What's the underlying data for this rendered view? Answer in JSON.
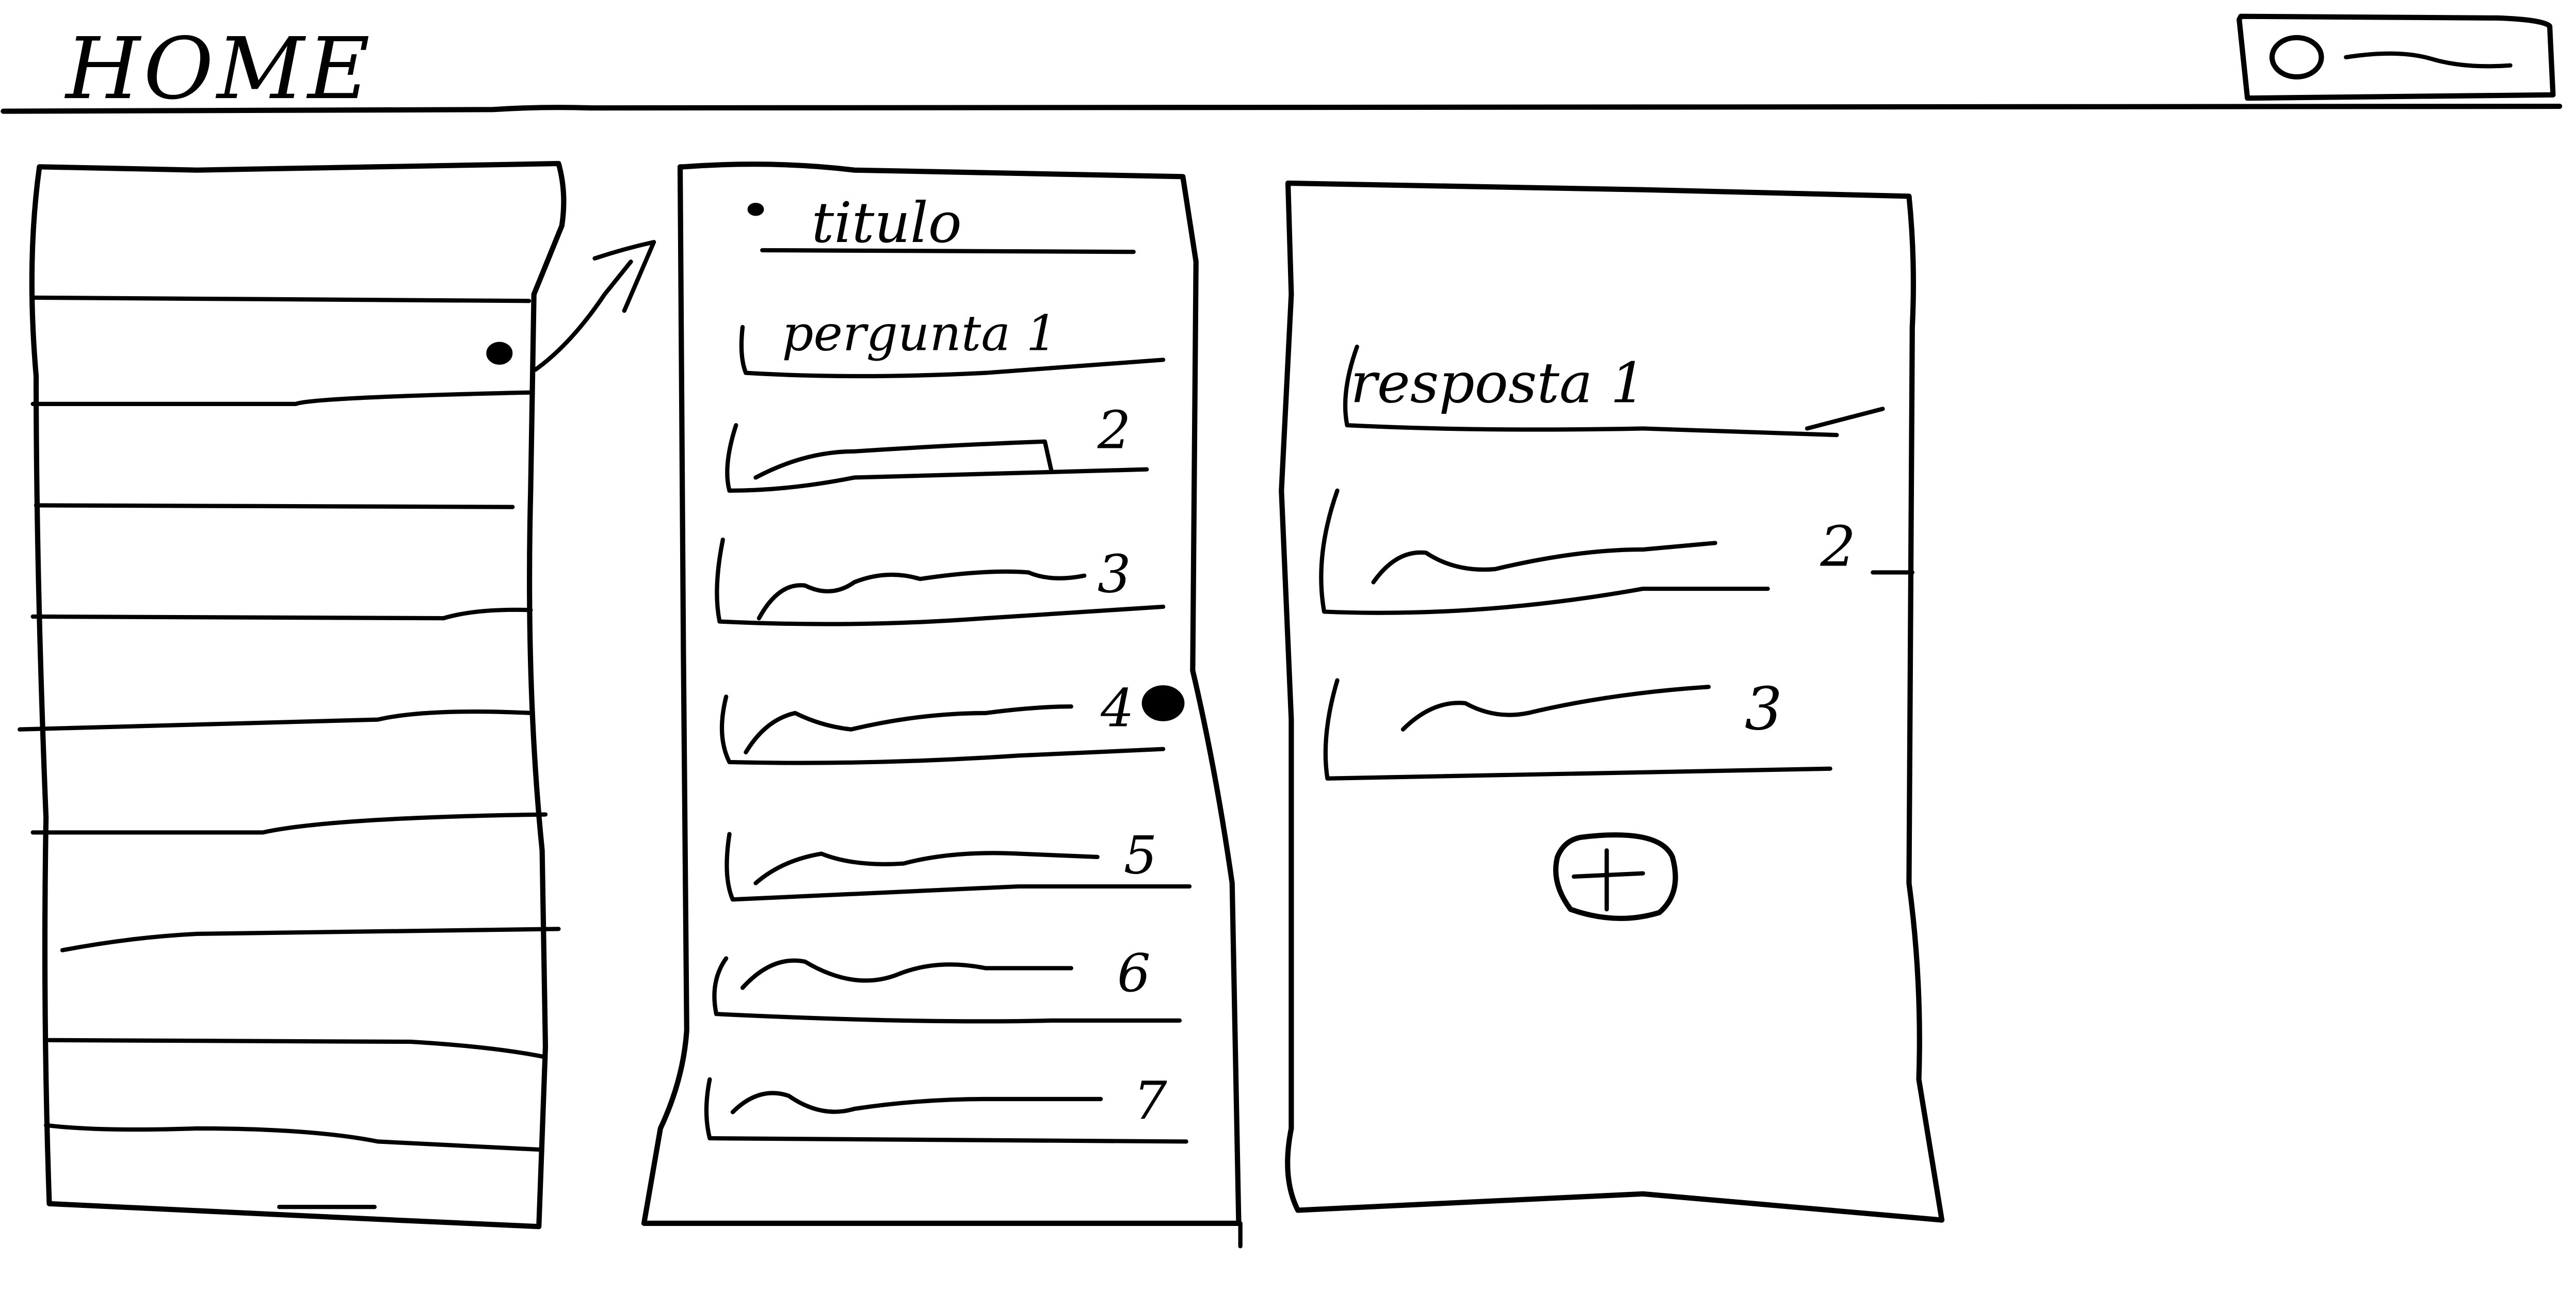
{
  "header": {
    "title": "HOME"
  },
  "questions_panel": {
    "title": "titulo",
    "items": [
      {
        "label": "pergunta 1"
      },
      {
        "label": "2"
      },
      {
        "label": "3"
      },
      {
        "label": "4"
      },
      {
        "label": "5"
      },
      {
        "label": "6"
      },
      {
        "label": "7"
      }
    ]
  },
  "answers_panel": {
    "items": [
      {
        "label": "resposta 1"
      },
      {
        "label": "2"
      },
      {
        "label": "3"
      }
    ],
    "add_icon": "plus-icon"
  },
  "user_menu": {
    "avatar_icon": "avatar-circle-icon"
  }
}
